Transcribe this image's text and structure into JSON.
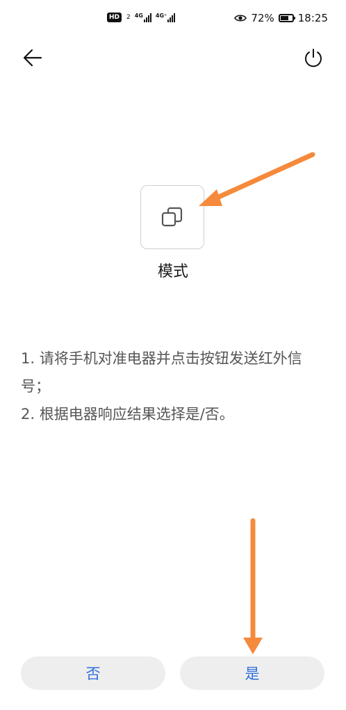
{
  "status_bar": {
    "hd_label": "HD",
    "hd_sub": "2",
    "net1_label": "4G",
    "net2_label": "4G⁺",
    "battery_percent": "72%",
    "battery_level": 0.72,
    "time": "18:25"
  },
  "header": {
    "back_icon": "arrow-left-icon",
    "power_icon": "power-icon"
  },
  "mode": {
    "icon": "copy-layers-icon",
    "label": "模式"
  },
  "instructions": {
    "line1": "1. 请将手机对准电器并点击按钮发送红外信号；",
    "line2": "2. 根据电器响应结果选择是/否。"
  },
  "buttons": {
    "no_label": "否",
    "yes_label": "是"
  },
  "colors": {
    "accent": "#2f6fdc",
    "annotation": "#f58a3c",
    "button_bg": "#eeeeee"
  }
}
